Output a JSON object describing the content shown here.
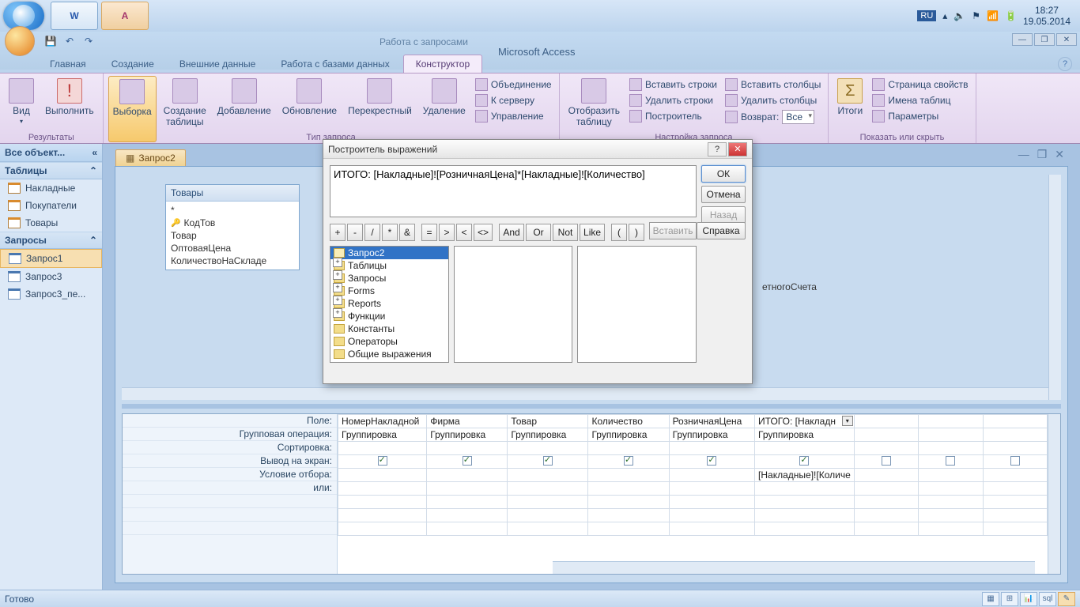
{
  "taskbar": {
    "tray": {
      "lang": "RU",
      "time": "18:27",
      "date": "19.05.2014"
    }
  },
  "titlebar": {
    "context_title": "Работа с запросами",
    "app_title": "Microsoft Access"
  },
  "tabs": {
    "home": "Главная",
    "create": "Создание",
    "external": "Внешние данные",
    "dbtools": "Работа с базами данных",
    "design": "Конструктор"
  },
  "ribbon": {
    "results": {
      "view": "Вид",
      "run": "Выполнить",
      "label": "Результаты"
    },
    "qtype": {
      "select": "Выборка",
      "maketable": "Создание\nтаблицы",
      "append": "Добавление",
      "update": "Обновление",
      "crosstab": "Перекрестный",
      "delete": "Удаление",
      "union": "Объединение",
      "passthru": "К серверу",
      "datadef": "Управление",
      "label": "Тип запроса"
    },
    "setup": {
      "showtable": "Отобразить\nтаблицу",
      "insrows": "Вставить строки",
      "delrows": "Удалить строки",
      "builder": "Построитель",
      "inscols": "Вставить столбцы",
      "delcols": "Удалить столбцы",
      "return": "Возврат:",
      "return_val": "Все",
      "label": "Настройка запроса"
    },
    "showhide": {
      "totals": "Итоги",
      "propsheet": "Страница свойств",
      "tablenames": "Имена таблиц",
      "params": "Параметры",
      "label": "Показать или скрыть"
    }
  },
  "nav": {
    "header": "Все объект...",
    "tables_hdr": "Таблицы",
    "queries_hdr": "Запросы",
    "tables": [
      "Накладные",
      "Покупатели",
      "Товары"
    ],
    "queries": [
      "Запрос1",
      "Запрос3",
      "Запрос3_пе..."
    ]
  },
  "doc": {
    "tab": "Запрос2",
    "table1": {
      "title": "Товары",
      "star": "*",
      "f1": "КодТов",
      "f2": "Товар",
      "f3": "ОптоваяЦена",
      "f4": "КоличествоНаСкладе"
    },
    "hidden_field": "етногоСчета"
  },
  "qbe": {
    "rows": {
      "field": "Поле:",
      "total": "Групповая операция:",
      "sort": "Сортировка:",
      "show": "Вывод на экран:",
      "criteria": "Условие отбора:",
      "or": "или:"
    },
    "cols": [
      {
        "field": "НомерНакладной",
        "total": "Группировка",
        "show": true,
        "crit": ""
      },
      {
        "field": "Фирма",
        "total": "Группировка",
        "show": true,
        "crit": ""
      },
      {
        "field": "Товар",
        "total": "Группировка",
        "show": true,
        "crit": ""
      },
      {
        "field": "Количество",
        "total": "Группировка",
        "show": true,
        "crit": ""
      },
      {
        "field": "РозничнаяЦена",
        "total": "Группировка",
        "show": true,
        "crit": ""
      },
      {
        "field": "ИТОГО: [Накладн",
        "total": "Группировка",
        "show": true,
        "crit": "[Накладные]![Количе"
      },
      {
        "field": "",
        "total": "",
        "show": false,
        "crit": ""
      },
      {
        "field": "",
        "total": "",
        "show": false,
        "crit": ""
      },
      {
        "field": "",
        "total": "",
        "show": false,
        "crit": ""
      }
    ]
  },
  "statusbar": {
    "text": "Готово"
  },
  "dialog": {
    "title": "Построитель выражений",
    "expr": "ИТОГО: [Накладные]![РозничнаяЦена]*[Накладные]![Количество]",
    "btns": {
      "ok": "ОК",
      "cancel": "Отмена",
      "back": "Назад",
      "paste": "Вставить",
      "help": "Справка"
    },
    "ops": {
      "and": "And",
      "or": "Or",
      "not": "Not",
      "like": "Like"
    },
    "tree": {
      "i0": "Запрос2",
      "i1": "Таблицы",
      "i2": "Запросы",
      "i3": "Forms",
      "i4": "Reports",
      "i5": "Функции",
      "i6": "Константы",
      "i7": "Операторы",
      "i8": "Общие выражения"
    }
  }
}
